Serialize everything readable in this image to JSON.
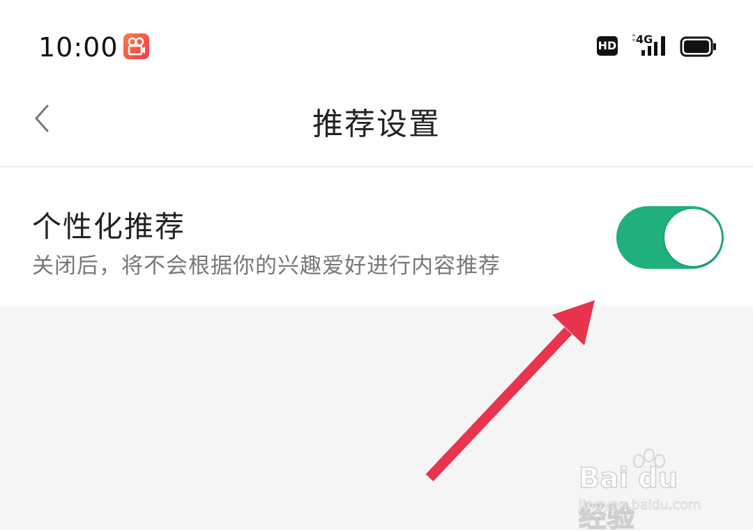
{
  "status_bar": {
    "time": "10:00",
    "hd_label": "HD",
    "network_label": "4G",
    "app_icon": "video-camera-app-icon",
    "signal_icon": "cellular-signal-icon",
    "battery_icon": "battery-icon"
  },
  "header": {
    "title": "推荐设置",
    "back_icon": "chevron-left-icon"
  },
  "setting": {
    "title": "个性化推荐",
    "description": "关闭后，将不会根据你的兴趣爱好进行内容推荐",
    "enabled": true
  },
  "annotation": {
    "arrow_color": "#e8344e",
    "points_to": "toggle"
  },
  "watermark": {
    "brand": "Bai du 经验",
    "url": "jingyan.baidu.com"
  },
  "colors": {
    "toggle_on": "#1fb07b",
    "background": "#f5f5f5"
  }
}
